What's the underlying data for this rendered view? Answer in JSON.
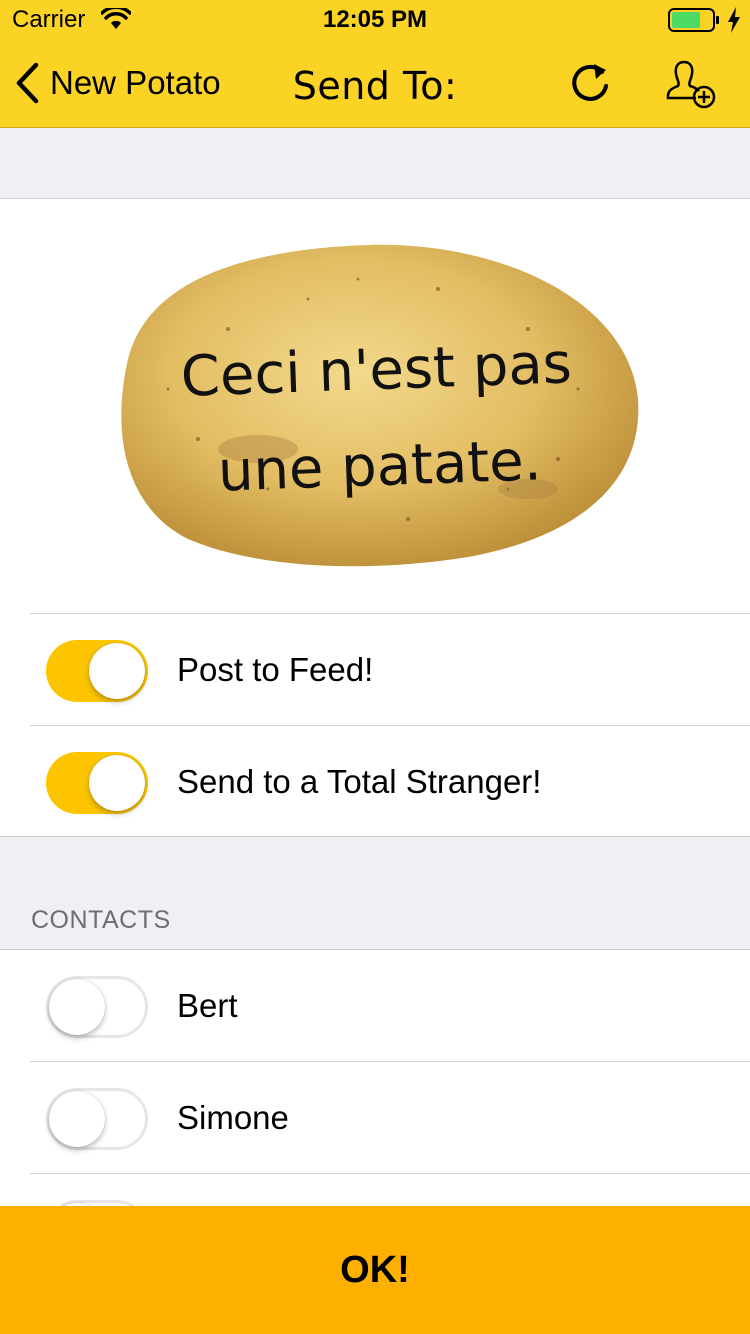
{
  "status_bar": {
    "carrier": "Carrier",
    "time": "12:05 PM",
    "battery_color": "#4cd964"
  },
  "nav": {
    "back_label": "New Potato",
    "title": "Send To:",
    "refresh_icon": "refresh-icon",
    "add_contact_icon": "add-contact-icon"
  },
  "potato": {
    "text_line1": "Ceci n'est pas",
    "text_line2": "une patate."
  },
  "options": [
    {
      "label": "Post to Feed!",
      "on": true
    },
    {
      "label": "Send to a Total Stranger!",
      "on": true
    }
  ],
  "contacts": {
    "header": "CONTACTS",
    "items": [
      {
        "label": "Bert",
        "on": false
      },
      {
        "label": "Simone",
        "on": false
      }
    ]
  },
  "ok_button": {
    "label": "OK!"
  },
  "colors": {
    "nav_yellow": "#fbd324",
    "toggle_on": "#fcc500",
    "ok_orange": "#fdb000"
  }
}
